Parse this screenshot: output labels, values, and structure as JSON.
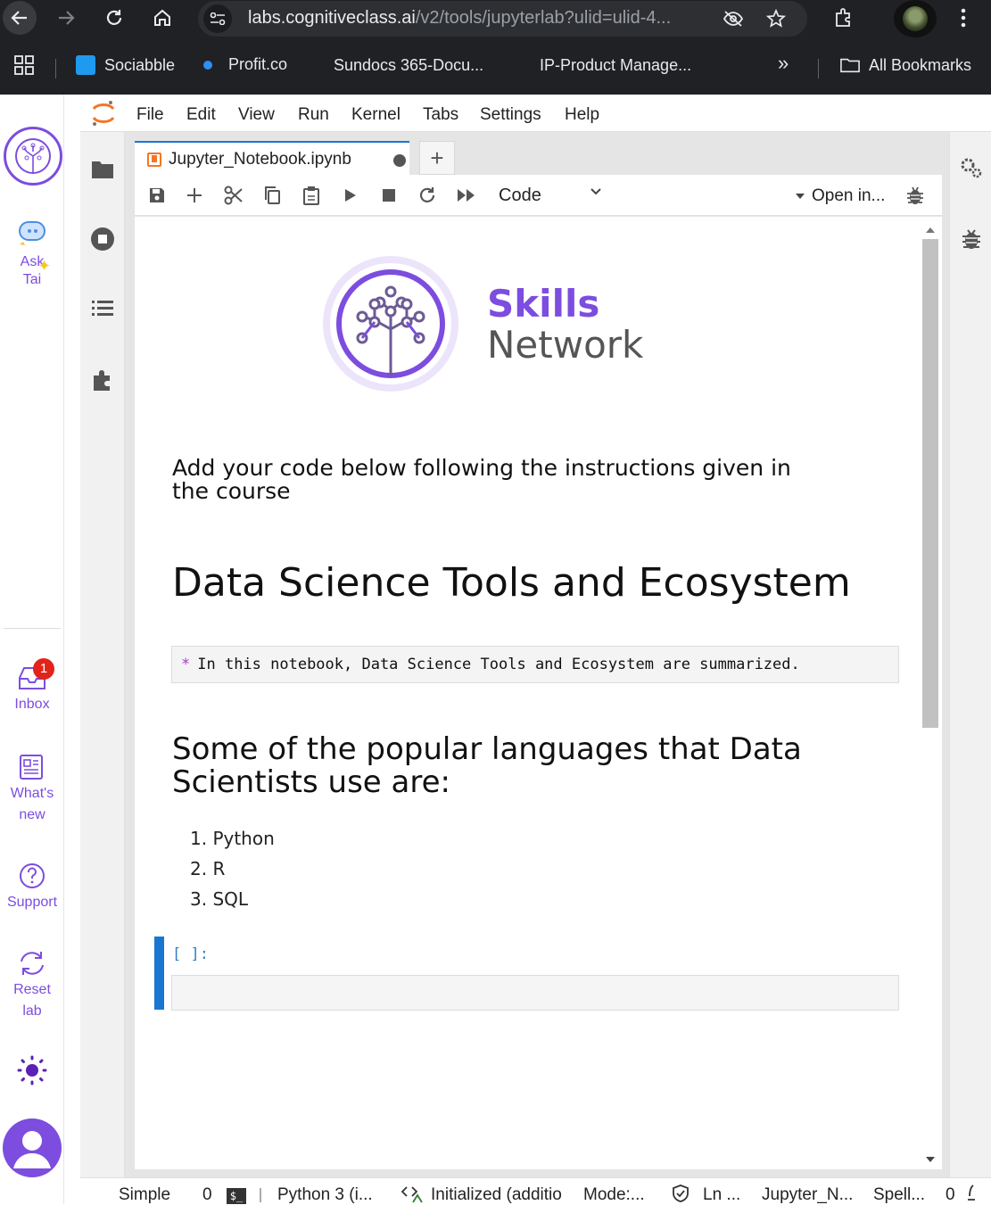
{
  "browser": {
    "url_host": "labs.cognitiveclass.ai",
    "url_path": "/v2/tools/jupyterlab?ulid=ulid-4...",
    "bookmarks": [
      {
        "label": "Sociabble"
      },
      {
        "label": "Profit.co"
      },
      {
        "label": "Sundocs 365-Docu..."
      },
      {
        "label": "IP-Product Manage..."
      }
    ],
    "all_bookmarks_label": "All Bookmarks",
    "overflow_label": "»"
  },
  "skills_sidebar": {
    "ask_label_1": "Ask",
    "ask_label_2": "Tai",
    "inbox_badge": "1",
    "inbox_label": "Inbox",
    "whats_new_1": "What's",
    "whats_new_2": "new",
    "support_label": "Support",
    "reset_1": "Reset",
    "reset_2": "lab"
  },
  "menu": [
    "File",
    "Edit",
    "View",
    "Run",
    "Kernel",
    "Tabs",
    "Settings",
    "Help"
  ],
  "tab": {
    "label": "Jupyter_Notebook.ipynb",
    "add_label": "+"
  },
  "toolbar": {
    "cell_type": "Code",
    "open_in": "Open in..."
  },
  "notebook": {
    "logo_word1": "Skills",
    "logo_word2": "Network",
    "instructions": "Add your code below following the instructions given in the course",
    "title": "Data Science Tools and Ecosystem",
    "intro_code": "In this notebook, Data Science Tools and Ecosystem are summarized.",
    "intro_bullet": "*",
    "languages_heading": "Some of the popular languages that Data Scientists use are:",
    "languages": [
      "1. Python",
      "2. R",
      "3. SQL"
    ],
    "prompt": "[ ]:"
  },
  "statusbar": {
    "mode": "Simple",
    "terminals": "0",
    "terminal_glyph": "$_",
    "kernel": "Python 3 (i...",
    "lsp": "Initialized (additio",
    "edit_mode": "Mode:...",
    "position": "Ln ...",
    "file": "Jupyter_N...",
    "spell": "Spell...",
    "notifications": "0"
  }
}
